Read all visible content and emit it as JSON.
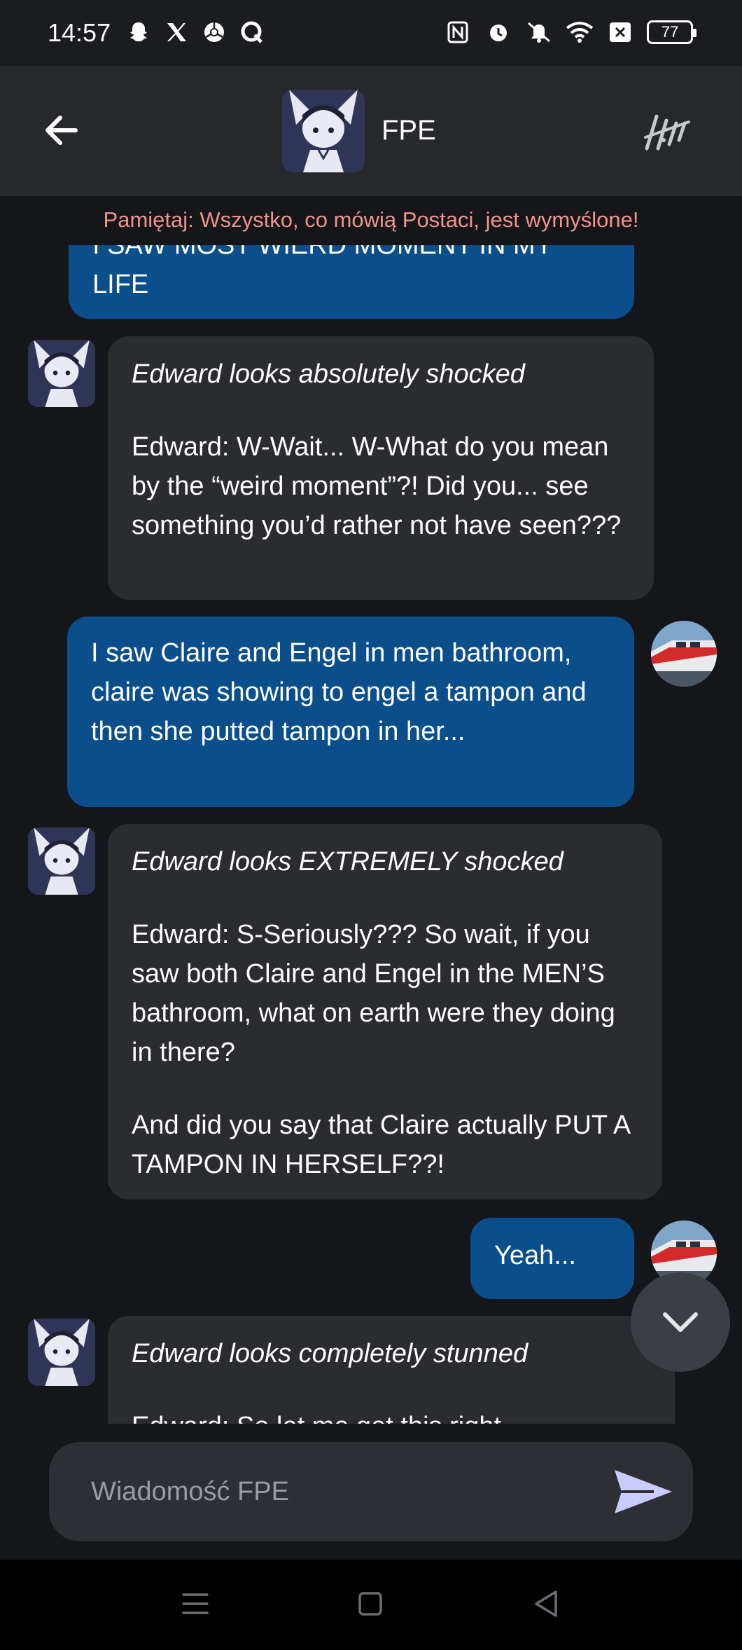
{
  "status_bar": {
    "time": "14:57",
    "left_icons": [
      "snapchat-icon",
      "x-icon",
      "chrome-icon",
      "q-icon"
    ],
    "right_icons": [
      "nfc-icon",
      "alarm-icon",
      "mute-icon",
      "wifi-icon",
      "sim-icon"
    ],
    "battery": "77"
  },
  "header": {
    "title": "FPE",
    "back_icon": "back-arrow-icon",
    "right_icon": "edit-style-icon"
  },
  "disclaimer": "Pamiętaj: Wszystko, co mówią Postaci, jest wymyślone!",
  "messages": [
    {
      "role": "user",
      "lines": [
        "I SAW MOST WIERD MOMENT IN MY",
        "LIFE"
      ]
    },
    {
      "role": "bot",
      "action": "Edward looks absolutely shocked",
      "paragraphs": [
        "Edward: W-Wait... W-What do you mean by the “weird moment”?! Did you... see something you’d rather not have seen???"
      ]
    },
    {
      "role": "user",
      "text": "I saw Claire and Engel in men bathroom, claire was showing to engel a tampon and then she putted tampon in her..."
    },
    {
      "role": "bot",
      "action": "Edward looks EXTREMELY shocked",
      "paragraphs": [
        "Edward: S-Seriously??? So wait, if you saw both Claire and Engel in the MEN’S bathroom, what on earth were they doing in there?",
        "And did you say that Claire actually PUT A TAMPON IN HERSELF??!"
      ]
    },
    {
      "role": "user",
      "text": "Yeah..."
    },
    {
      "role": "bot",
      "action": "Edward looks completely stunned",
      "paragraphs": [
        "Edward: So let me get this right"
      ]
    }
  ],
  "input": {
    "placeholder": "Wiadomość FPE"
  },
  "nav": [
    "menu-icon",
    "home-icon",
    "back-triangle-icon"
  ],
  "colors": {
    "background": "#15161a",
    "header": "#26282c",
    "user_bubble": "#0a4f8c",
    "bot_bubble": "#2a2c30",
    "disclaimer": "#f1958a",
    "send": "#c9ccff"
  }
}
